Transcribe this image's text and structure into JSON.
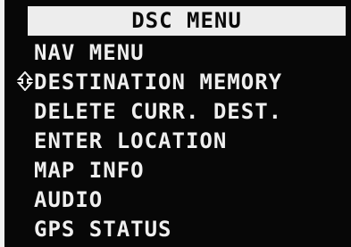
{
  "title": "DSC MENU",
  "menu": {
    "items": [
      {
        "label": "NAV MENU"
      },
      {
        "label": "DESTINATION MEMORY"
      },
      {
        "label": "DELETE CURR. DEST."
      },
      {
        "label": "ENTER LOCATION"
      },
      {
        "label": "MAP INFO"
      },
      {
        "label": "AUDIO"
      },
      {
        "label": "GPS STATUS"
      }
    ],
    "selected_index": 1
  },
  "icons": {
    "cursor": "up-down-selector-icon"
  },
  "colors": {
    "background": "#070707",
    "text": "#efefef",
    "title_bar": "#ededed",
    "title_text": "#0a0a0a"
  }
}
